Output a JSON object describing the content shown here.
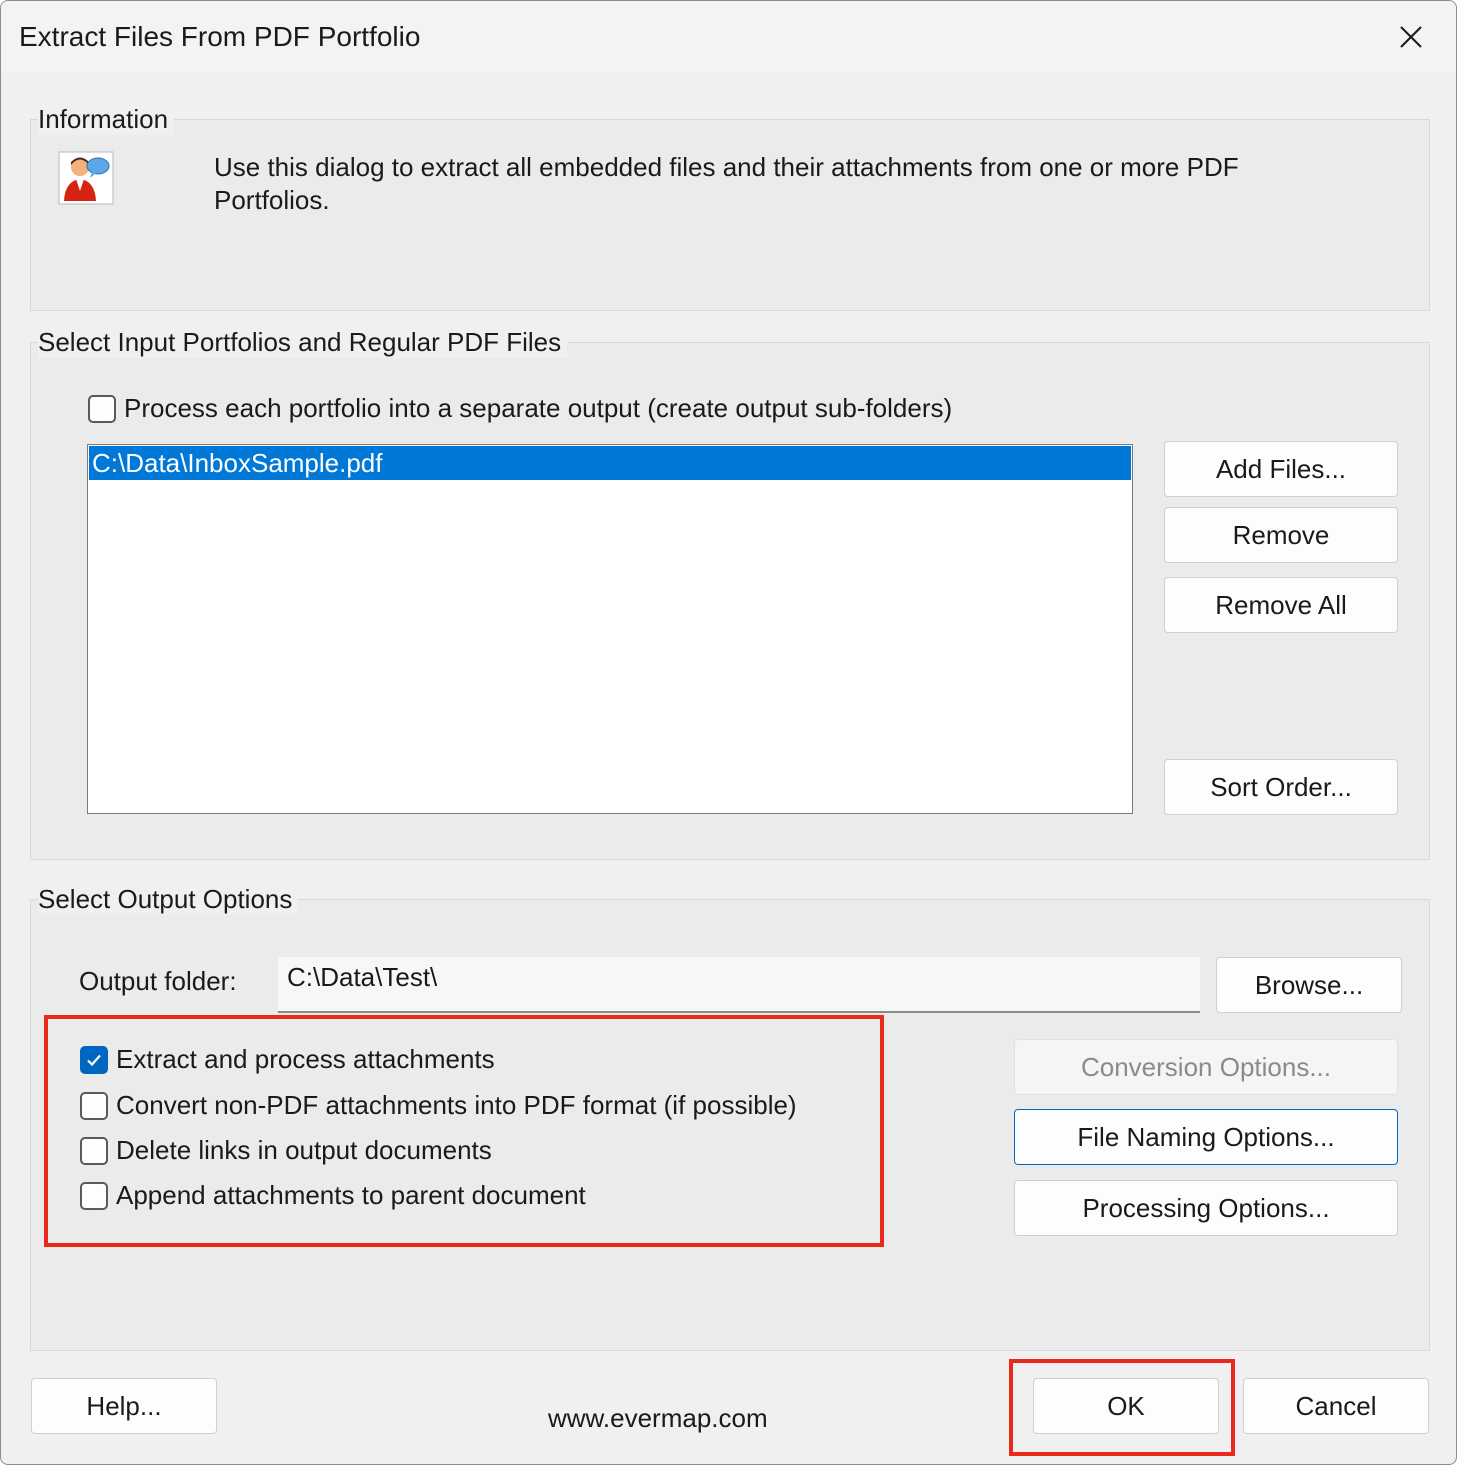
{
  "window": {
    "title": "Extract Files From PDF Portfolio",
    "close_icon": "close-icon"
  },
  "information": {
    "label": "Information",
    "icon": "user-help-icon",
    "text": "Use this dialog to extract all embedded files and their attachments from one or more PDF Portfolios."
  },
  "input": {
    "label": "Select Input Portfolios and Regular PDF Files",
    "separate_output_checkbox": {
      "label": "Process each portfolio into a separate output (create output sub-folders)",
      "checked": false
    },
    "files": [
      {
        "path": "C:\\Data\\InboxSample.pdf",
        "selected": true
      }
    ],
    "buttons": {
      "add_files": "Add Files...",
      "remove": "Remove",
      "remove_all": "Remove All",
      "sort_order": "Sort Order..."
    }
  },
  "output": {
    "label": "Select Output Options",
    "folder_label": "Output folder:",
    "folder_value": "C:\\Data\\Test\\",
    "browse": "Browse...",
    "options": [
      {
        "label": "Extract and process attachments",
        "checked": true
      },
      {
        "label": "Convert non-PDF attachments into PDF format (if possible)",
        "checked": false
      },
      {
        "label": "Delete links in output documents",
        "checked": false
      },
      {
        "label": "Append attachments to parent document",
        "checked": false
      }
    ],
    "conversion_options": "Conversion Options...",
    "file_naming_options": "File Naming Options...",
    "processing_options": "Processing Options..."
  },
  "footer": {
    "help": "Help...",
    "website": "www.evermap.com",
    "ok": "OK",
    "cancel": "Cancel"
  },
  "colors": {
    "accent": "#0067c0",
    "selection": "#0078d7",
    "highlight": "#e8291c"
  }
}
